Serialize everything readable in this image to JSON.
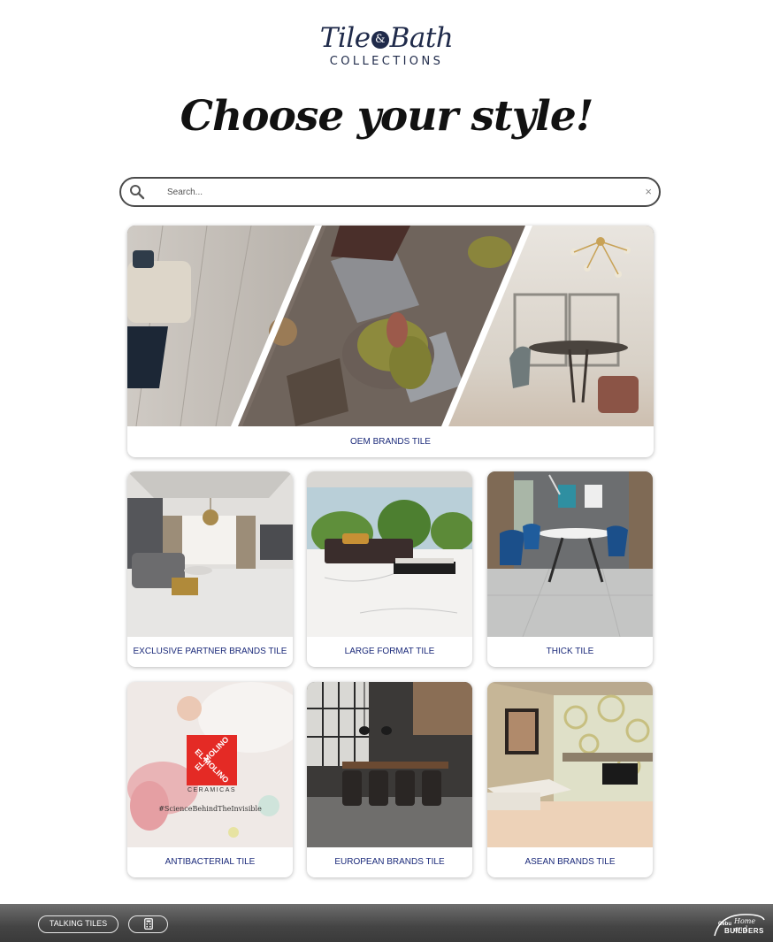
{
  "logo": {
    "script_left": "Tile",
    "ampersand": "&",
    "script_right": "Bath",
    "subtitle": "COLLECTIONS"
  },
  "hero": {
    "title": "Choose your style!"
  },
  "search": {
    "placeholder": "Search...",
    "value": "",
    "clear_symbol": "×"
  },
  "featured": {
    "label": "OEM BRANDS TILE"
  },
  "categories": [
    {
      "label": "EXCLUSIVE PARTNER BRANDS TILE"
    },
    {
      "label": "LARGE FORMAT TILE"
    },
    {
      "label": "THICK TILE"
    },
    {
      "label": "ANTIBACTERIAL TILE"
    },
    {
      "label": "EUROPEAN BRANDS TILE"
    },
    {
      "label": "ASEAN BRANDS TILE"
    }
  ],
  "antibacterial_promo": {
    "logo_line1": "EL MOLINO",
    "logo_line2": "EL MOLINO",
    "brand_sub": "CERAMICAS",
    "hashtag": "#ScienceBehindTheInvisible"
  },
  "bottom_bar": {
    "talking_tiles_label": "TALKING TILES",
    "calculator_icon": "calculator-icon",
    "brand_text_1": "Cebu",
    "brand_text_2": "Home and",
    "brand_text_3": "BUILDERS"
  },
  "colors": {
    "label_blue": "#1b2a7a",
    "logo_navy": "#1f2a4a",
    "bar_gray": "#4a4a4a"
  }
}
